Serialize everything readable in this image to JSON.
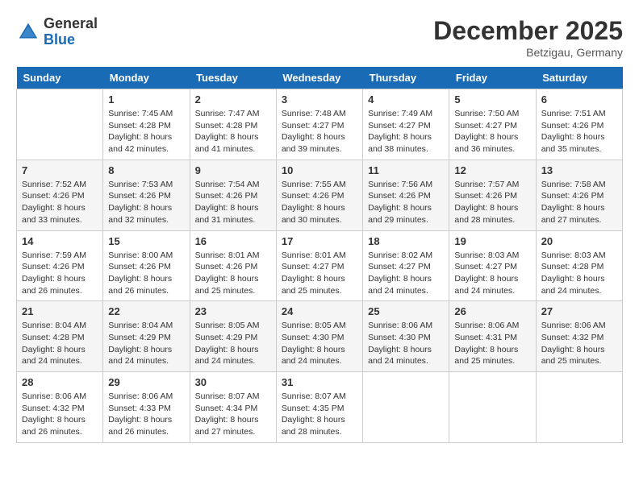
{
  "header": {
    "logo_general": "General",
    "logo_blue": "Blue",
    "month_title": "December 2025",
    "location": "Betzigau, Germany"
  },
  "calendar": {
    "days_of_week": [
      "Sunday",
      "Monday",
      "Tuesday",
      "Wednesday",
      "Thursday",
      "Friday",
      "Saturday"
    ],
    "weeks": [
      [
        {
          "day": "",
          "info": ""
        },
        {
          "day": "1",
          "info": "Sunrise: 7:45 AM\nSunset: 4:28 PM\nDaylight: 8 hours\nand 42 minutes."
        },
        {
          "day": "2",
          "info": "Sunrise: 7:47 AM\nSunset: 4:28 PM\nDaylight: 8 hours\nand 41 minutes."
        },
        {
          "day": "3",
          "info": "Sunrise: 7:48 AM\nSunset: 4:27 PM\nDaylight: 8 hours\nand 39 minutes."
        },
        {
          "day": "4",
          "info": "Sunrise: 7:49 AM\nSunset: 4:27 PM\nDaylight: 8 hours\nand 38 minutes."
        },
        {
          "day": "5",
          "info": "Sunrise: 7:50 AM\nSunset: 4:27 PM\nDaylight: 8 hours\nand 36 minutes."
        },
        {
          "day": "6",
          "info": "Sunrise: 7:51 AM\nSunset: 4:26 PM\nDaylight: 8 hours\nand 35 minutes."
        }
      ],
      [
        {
          "day": "7",
          "info": "Sunrise: 7:52 AM\nSunset: 4:26 PM\nDaylight: 8 hours\nand 33 minutes."
        },
        {
          "day": "8",
          "info": "Sunrise: 7:53 AM\nSunset: 4:26 PM\nDaylight: 8 hours\nand 32 minutes."
        },
        {
          "day": "9",
          "info": "Sunrise: 7:54 AM\nSunset: 4:26 PM\nDaylight: 8 hours\nand 31 minutes."
        },
        {
          "day": "10",
          "info": "Sunrise: 7:55 AM\nSunset: 4:26 PM\nDaylight: 8 hours\nand 30 minutes."
        },
        {
          "day": "11",
          "info": "Sunrise: 7:56 AM\nSunset: 4:26 PM\nDaylight: 8 hours\nand 29 minutes."
        },
        {
          "day": "12",
          "info": "Sunrise: 7:57 AM\nSunset: 4:26 PM\nDaylight: 8 hours\nand 28 minutes."
        },
        {
          "day": "13",
          "info": "Sunrise: 7:58 AM\nSunset: 4:26 PM\nDaylight: 8 hours\nand 27 minutes."
        }
      ],
      [
        {
          "day": "14",
          "info": "Sunrise: 7:59 AM\nSunset: 4:26 PM\nDaylight: 8 hours\nand 26 minutes."
        },
        {
          "day": "15",
          "info": "Sunrise: 8:00 AM\nSunset: 4:26 PM\nDaylight: 8 hours\nand 26 minutes."
        },
        {
          "day": "16",
          "info": "Sunrise: 8:01 AM\nSunset: 4:26 PM\nDaylight: 8 hours\nand 25 minutes."
        },
        {
          "day": "17",
          "info": "Sunrise: 8:01 AM\nSunset: 4:27 PM\nDaylight: 8 hours\nand 25 minutes."
        },
        {
          "day": "18",
          "info": "Sunrise: 8:02 AM\nSunset: 4:27 PM\nDaylight: 8 hours\nand 24 minutes."
        },
        {
          "day": "19",
          "info": "Sunrise: 8:03 AM\nSunset: 4:27 PM\nDaylight: 8 hours\nand 24 minutes."
        },
        {
          "day": "20",
          "info": "Sunrise: 8:03 AM\nSunset: 4:28 PM\nDaylight: 8 hours\nand 24 minutes."
        }
      ],
      [
        {
          "day": "21",
          "info": "Sunrise: 8:04 AM\nSunset: 4:28 PM\nDaylight: 8 hours\nand 24 minutes."
        },
        {
          "day": "22",
          "info": "Sunrise: 8:04 AM\nSunset: 4:29 PM\nDaylight: 8 hours\nand 24 minutes."
        },
        {
          "day": "23",
          "info": "Sunrise: 8:05 AM\nSunset: 4:29 PM\nDaylight: 8 hours\nand 24 minutes."
        },
        {
          "day": "24",
          "info": "Sunrise: 8:05 AM\nSunset: 4:30 PM\nDaylight: 8 hours\nand 24 minutes."
        },
        {
          "day": "25",
          "info": "Sunrise: 8:06 AM\nSunset: 4:30 PM\nDaylight: 8 hours\nand 24 minutes."
        },
        {
          "day": "26",
          "info": "Sunrise: 8:06 AM\nSunset: 4:31 PM\nDaylight: 8 hours\nand 25 minutes."
        },
        {
          "day": "27",
          "info": "Sunrise: 8:06 AM\nSunset: 4:32 PM\nDaylight: 8 hours\nand 25 minutes."
        }
      ],
      [
        {
          "day": "28",
          "info": "Sunrise: 8:06 AM\nSunset: 4:32 PM\nDaylight: 8 hours\nand 26 minutes."
        },
        {
          "day": "29",
          "info": "Sunrise: 8:06 AM\nSunset: 4:33 PM\nDaylight: 8 hours\nand 26 minutes."
        },
        {
          "day": "30",
          "info": "Sunrise: 8:07 AM\nSunset: 4:34 PM\nDaylight: 8 hours\nand 27 minutes."
        },
        {
          "day": "31",
          "info": "Sunrise: 8:07 AM\nSunset: 4:35 PM\nDaylight: 8 hours\nand 28 minutes."
        },
        {
          "day": "",
          "info": ""
        },
        {
          "day": "",
          "info": ""
        },
        {
          "day": "",
          "info": ""
        }
      ]
    ]
  }
}
